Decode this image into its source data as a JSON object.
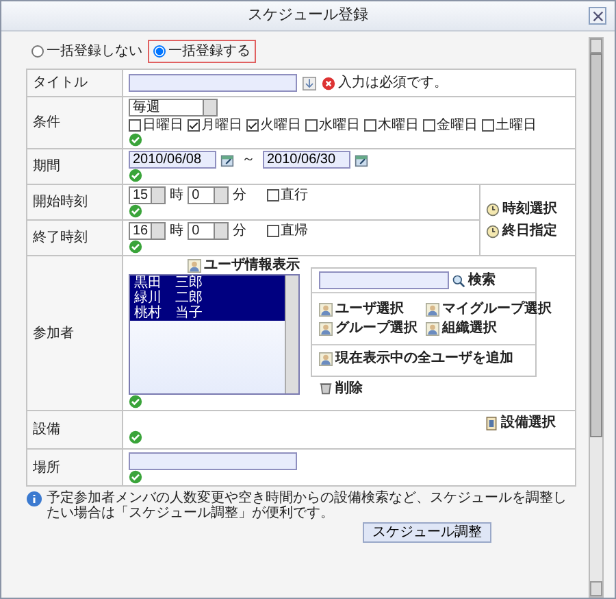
{
  "window": {
    "title": "スケジュール登録"
  },
  "bulk_options": [
    {
      "label": "一括登録しない",
      "selected": false
    },
    {
      "label": "一括登録する",
      "selected": true
    }
  ],
  "title_row": {
    "label": "タイトル",
    "required_message": "入力は必須です。"
  },
  "condition": {
    "label": "条件",
    "repeat": "毎週",
    "days": [
      {
        "label": "日曜日",
        "checked": false
      },
      {
        "label": "月曜日",
        "checked": true
      },
      {
        "label": "火曜日",
        "checked": true
      },
      {
        "label": "水曜日",
        "checked": false
      },
      {
        "label": "木曜日",
        "checked": false
      },
      {
        "label": "金曜日",
        "checked": false
      },
      {
        "label": "土曜日",
        "checked": false
      }
    ]
  },
  "period": {
    "label": "期間",
    "start": "2010/06/08",
    "separator": "～",
    "end": "2010/06/30"
  },
  "times": [
    {
      "label": "開始時刻",
      "hour": "15",
      "hour_unit": "時",
      "minute": "0",
      "minute_unit": "分",
      "option": {
        "label": "直行",
        "checked": false
      }
    },
    {
      "label": "終了時刻",
      "hour": "16",
      "hour_unit": "時",
      "minute": "0",
      "minute_unit": "分",
      "option": {
        "label": "直帰",
        "checked": false
      }
    }
  ],
  "time_actions": [
    "時刻選択",
    "終日指定"
  ],
  "participants": {
    "label": "参加者",
    "user_info": "ユーザ情報表示",
    "members": [
      {
        "name": "黒田　三郎",
        "selected": true
      },
      {
        "name": "緑川　二郎",
        "selected": true
      },
      {
        "name": "桃村　当子",
        "selected": true
      }
    ],
    "search_button": "検索",
    "select_buttons": [
      "ユーザ選択",
      "マイグループ選択",
      "グループ選択",
      "組織選択"
    ],
    "add_all": "現在表示中の全ユーザを追加",
    "delete": "削除"
  },
  "equipment": {
    "label": "設備",
    "select": "設備選択"
  },
  "place": {
    "label": "場所"
  },
  "info": "予定参加者メンバの人数変更や空き時間からの設備検索など、スケジュールを調整したい場合は「スケジュール調整」が便利です。",
  "adjust_button": "スケジュール調整"
}
